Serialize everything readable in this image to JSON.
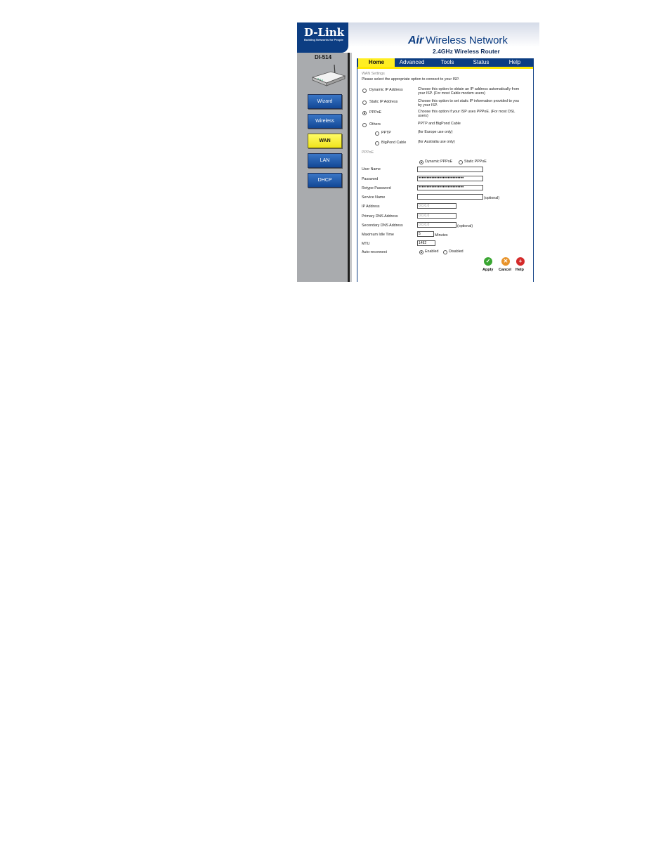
{
  "header": {
    "logo": "D-Link",
    "tagline": "Building Networks for People",
    "brand_air": "Air",
    "brand_name": "Wireless Network",
    "subtitle": "2.4GHz Wireless Router"
  },
  "sidebar": {
    "model": "DI-514",
    "items": [
      {
        "label": "Wizard"
      },
      {
        "label": "Wireless"
      },
      {
        "label": "WAN"
      },
      {
        "label": "LAN"
      },
      {
        "label": "DHCP"
      }
    ]
  },
  "tabs": [
    {
      "label": "Home"
    },
    {
      "label": "Advanced"
    },
    {
      "label": "Tools"
    },
    {
      "label": "Status"
    },
    {
      "label": "Help"
    }
  ],
  "wan": {
    "section_title": "WAN Settings",
    "intro": "Please select the appropriate option to connect to your ISP.",
    "options": [
      {
        "label": "Dynamic IP Address",
        "desc": "Choose this option to obtain an IP address automatically from your ISP. (For most Cable modem users)"
      },
      {
        "label": "Static IP Address",
        "desc": "Choose this option to set static IP information provided to you by your ISP."
      },
      {
        "label": "PPPoE",
        "desc": "Choose this option if your ISP uses PPPoE. (For most DSL users)"
      },
      {
        "label": "Others",
        "desc": "PPTP and BigPond Cable"
      }
    ],
    "sub_options": [
      {
        "label": "PPTP",
        "desc": "(for Europe use only)"
      },
      {
        "label": "BigPond Cable",
        "desc": "(for Australia use only)"
      }
    ],
    "selected": "PPPoE"
  },
  "pppoe": {
    "section_title": "PPPoE",
    "mode_dynamic": "Dynamic PPPoE",
    "mode_static": "Static PPPoE",
    "user_name_label": "User Name",
    "user_name_value": "",
    "password_label": "Password",
    "password_value": "••••••••••••••••••••••••••••",
    "retype_label": "Retype Password",
    "retype_value": "••••••••••••••••••••••••••••",
    "service_label": "Service Name",
    "service_value": "",
    "optional": "(optional)",
    "ip_label": "IP Address",
    "ip_value": "0.0.0.0",
    "dns1_label": "Primary DNS Address",
    "dns1_value": "0.0.0.0",
    "dns2_label": "Secondary DNS Address",
    "dns2_value": "0.0.0.0",
    "idle_label": "Maximum Idle Time",
    "idle_value": "5",
    "idle_unit": "Minutes",
    "mtu_label": "MTU",
    "mtu_value": "1492",
    "reconnect_label": "Auto-reconnect",
    "enabled": "Enabled",
    "disabled": "Disabled"
  },
  "actions": {
    "apply": "Apply",
    "cancel": "Cancel",
    "help": "Help"
  },
  "colors": {
    "brand_blue": "#0c3d82",
    "accent_yellow": "#ffee22",
    "apply_green": "#3aa632",
    "cancel_orange": "#e8932a",
    "help_red": "#d42a2a"
  }
}
